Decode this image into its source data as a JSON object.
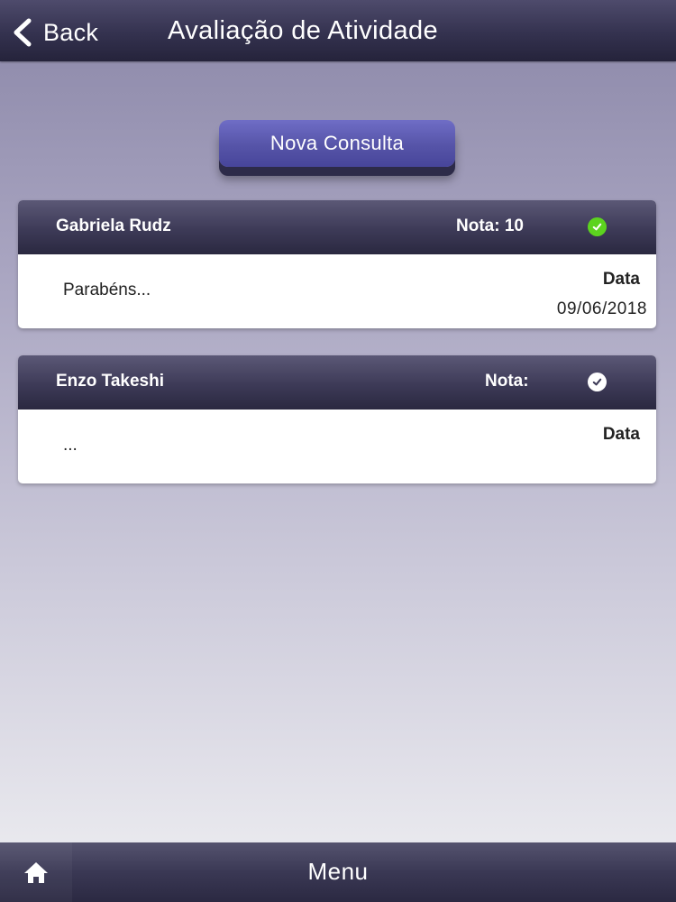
{
  "header": {
    "back_label": "Back",
    "title": "Avaliação de Atividade"
  },
  "actions": {
    "nova_consulta_label": "Nova Consulta"
  },
  "cards": [
    {
      "name": "Gabriela Rudz",
      "nota": "Nota: 10",
      "status_icon": "check-circle-icon",
      "status_color": "#5cd31f",
      "message": "Parabéns...",
      "data_label": "Data",
      "date": "09/06/2018"
    },
    {
      "name": "Enzo Takeshi",
      "nota": "Nota:",
      "status_icon": "check-circle-icon",
      "status_color": "#ffffff",
      "message": "...",
      "data_label": "Data",
      "date": ""
    }
  ],
  "footer": {
    "home_icon": "home-icon",
    "menu_label": "Menu"
  }
}
